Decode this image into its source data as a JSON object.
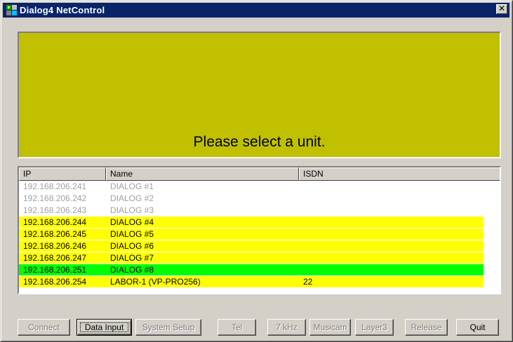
{
  "window": {
    "title": "Dialog4 NetControl",
    "close_glyph": "✕"
  },
  "display": {
    "message": "Please select a unit.",
    "background": "#c0c000"
  },
  "list": {
    "columns": [
      "IP",
      "Name",
      "ISDN"
    ],
    "rows": [
      {
        "ip": "192.168.206.241",
        "name": "DIALOG #1",
        "isdn": "",
        "state": "inactive"
      },
      {
        "ip": "192.168.206.242",
        "name": "DIALOG #2",
        "isdn": "",
        "state": "inactive"
      },
      {
        "ip": "192.168.206.243",
        "name": "DIALOG #3",
        "isdn": "",
        "state": "inactive"
      },
      {
        "ip": "192.168.206.244",
        "name": "DIALOG #4",
        "isdn": "",
        "state": "available"
      },
      {
        "ip": "192.168.206.245",
        "name": "DIALOG #5",
        "isdn": "",
        "state": "available"
      },
      {
        "ip": "192.168.206.246",
        "name": "DIALOG #6",
        "isdn": "",
        "state": "available"
      },
      {
        "ip": "192.168.206.247",
        "name": "DIALOG #7",
        "isdn": "",
        "state": "available"
      },
      {
        "ip": "192.168.206.251",
        "name": "DIALOG #8",
        "isdn": "",
        "state": "connected"
      },
      {
        "ip": "192.168.206.254",
        "name": "LABOR-1 (VP-PRO256)",
        "isdn": "22",
        "state": "available"
      }
    ],
    "colors": {
      "inactive_text": "#a0a0a0",
      "available_bg": "#ffff00",
      "connected_bg": "#00ff00"
    }
  },
  "buttons": [
    {
      "label": "Connect",
      "enabled": false
    },
    {
      "label": "Data Input",
      "enabled": true,
      "default": true
    },
    {
      "label": "System Setup",
      "enabled": false
    },
    {
      "label": "Tel",
      "enabled": false
    },
    {
      "label": "7 kHz",
      "enabled": false
    },
    {
      "label": "Musicam",
      "enabled": false
    },
    {
      "label": "Layer3",
      "enabled": false
    },
    {
      "label": "Release",
      "enabled": false
    },
    {
      "label": "Quit",
      "enabled": true
    }
  ]
}
